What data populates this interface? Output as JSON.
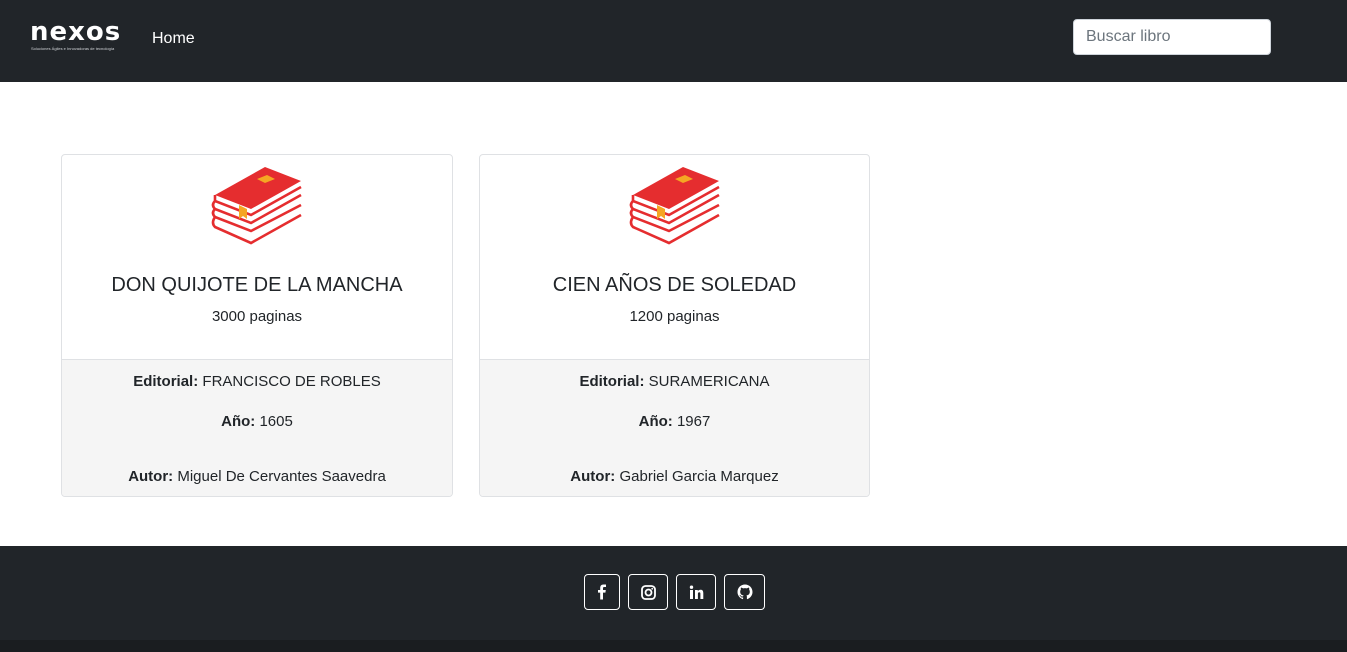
{
  "navbar": {
    "logo_text": "nexos",
    "logo_tagline": "Soluciones Ágiles e Innovadoras de tecnología",
    "home_label": "Home",
    "search_placeholder": "Buscar libro"
  },
  "books": [
    {
      "title": "DON QUIJOTE DE LA MANCHA",
      "pages": "3000 paginas",
      "editorial_label": "Editorial:",
      "editorial": "FRANCISCO DE ROBLES",
      "year_label": "Año:",
      "year": "1605",
      "author_label": "Autor:",
      "author": "Miguel De Cervantes Saavedra",
      "icon": "book-stack-icon"
    },
    {
      "title": "CIEN AÑOS DE SOLEDAD",
      "pages": "1200 paginas",
      "editorial_label": "Editorial:",
      "editorial": "SURAMERICANA",
      "year_label": "Año:",
      "year": "1967",
      "author_label": "Autor:",
      "author": "Gabriel Garcia Marquez",
      "icon": "book-stack-icon"
    }
  ],
  "footer": {
    "social": [
      "facebook-icon",
      "instagram-icon",
      "linkedin-icon",
      "github-icon"
    ]
  },
  "colors": {
    "navbar_bg": "#212529",
    "book_red": "#e52d2f",
    "book_accent": "#f5a623",
    "card_footer_bg": "#f5f5f5"
  }
}
